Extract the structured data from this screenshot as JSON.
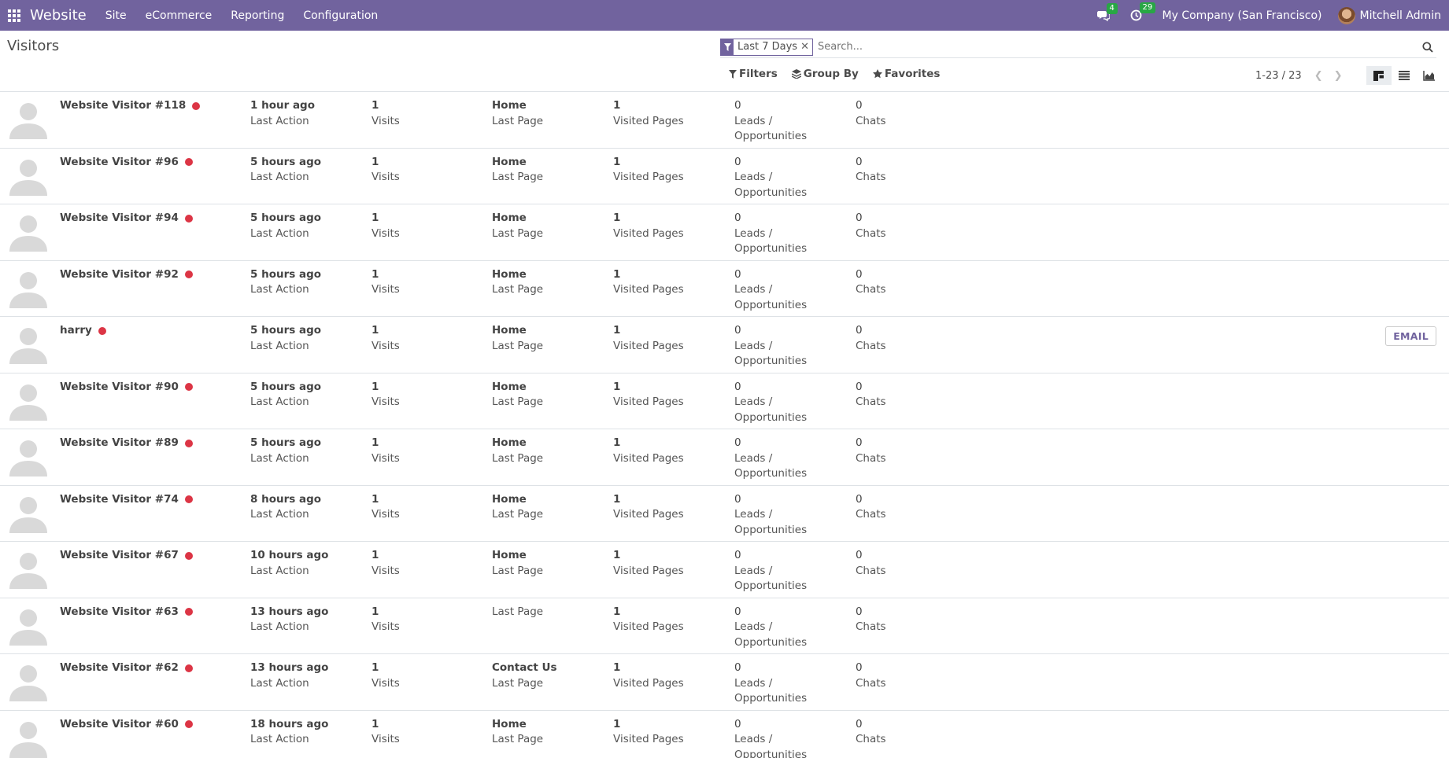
{
  "navbar": {
    "brand": "Website",
    "menu": [
      "Site",
      "eCommerce",
      "Reporting",
      "Configuration"
    ],
    "messages_count": "4",
    "activities_count": "29",
    "company": "My Company (San Francisco)",
    "user": "Mitchell Admin"
  },
  "control": {
    "title": "Visitors",
    "facet": "Last 7 Days",
    "search_placeholder": "Search...",
    "filters_label": "Filters",
    "groupby_label": "Group By",
    "favorites_label": "Favorites",
    "pager": "1-23 / 23"
  },
  "labels": {
    "last_action": "Last Action",
    "visits": "Visits",
    "last_page": "Last Page",
    "visited_pages": "Visited Pages",
    "leads_1": "Leads /",
    "leads_2": "Opportunities",
    "chats": "Chats",
    "email": "EMAIL"
  },
  "visitors": [
    {
      "name": "Website Visitor #118",
      "last_action": "1 hour ago",
      "visits": "1",
      "last_page": "Home",
      "visited_pages": "1",
      "leads": "0",
      "chats": "0"
    },
    {
      "name": "Website Visitor #96",
      "last_action": "5 hours ago",
      "visits": "1",
      "last_page": "Home",
      "visited_pages": "1",
      "leads": "0",
      "chats": "0"
    },
    {
      "name": "Website Visitor #94",
      "last_action": "5 hours ago",
      "visits": "1",
      "last_page": "Home",
      "visited_pages": "1",
      "leads": "0",
      "chats": "0"
    },
    {
      "name": "Website Visitor #92",
      "last_action": "5 hours ago",
      "visits": "1",
      "last_page": "Home",
      "visited_pages": "1",
      "leads": "0",
      "chats": "0"
    },
    {
      "name": "harry",
      "last_action": "5 hours ago",
      "visits": "1",
      "last_page": "Home",
      "visited_pages": "1",
      "leads": "0",
      "chats": "0",
      "email": true
    },
    {
      "name": "Website Visitor #90",
      "last_action": "5 hours ago",
      "visits": "1",
      "last_page": "Home",
      "visited_pages": "1",
      "leads": "0",
      "chats": "0"
    },
    {
      "name": "Website Visitor #89",
      "last_action": "5 hours ago",
      "visits": "1",
      "last_page": "Home",
      "visited_pages": "1",
      "leads": "0",
      "chats": "0"
    },
    {
      "name": "Website Visitor #74",
      "last_action": "8 hours ago",
      "visits": "1",
      "last_page": "Home",
      "visited_pages": "1",
      "leads": "0",
      "chats": "0"
    },
    {
      "name": "Website Visitor #67",
      "last_action": "10 hours ago",
      "visits": "1",
      "last_page": "Home",
      "visited_pages": "1",
      "leads": "0",
      "chats": "0"
    },
    {
      "name": "Website Visitor #63",
      "last_action": "13 hours ago",
      "visits": "1",
      "last_page": "",
      "visited_pages": "1",
      "leads": "0",
      "chats": "0"
    },
    {
      "name": "Website Visitor #62",
      "last_action": "13 hours ago",
      "visits": "1",
      "last_page": "Contact Us",
      "visited_pages": "1",
      "leads": "0",
      "chats": "0"
    },
    {
      "name": "Website Visitor #60",
      "last_action": "18 hours ago",
      "visits": "1",
      "last_page": "Home",
      "visited_pages": "1",
      "leads": "0",
      "chats": "0"
    }
  ]
}
